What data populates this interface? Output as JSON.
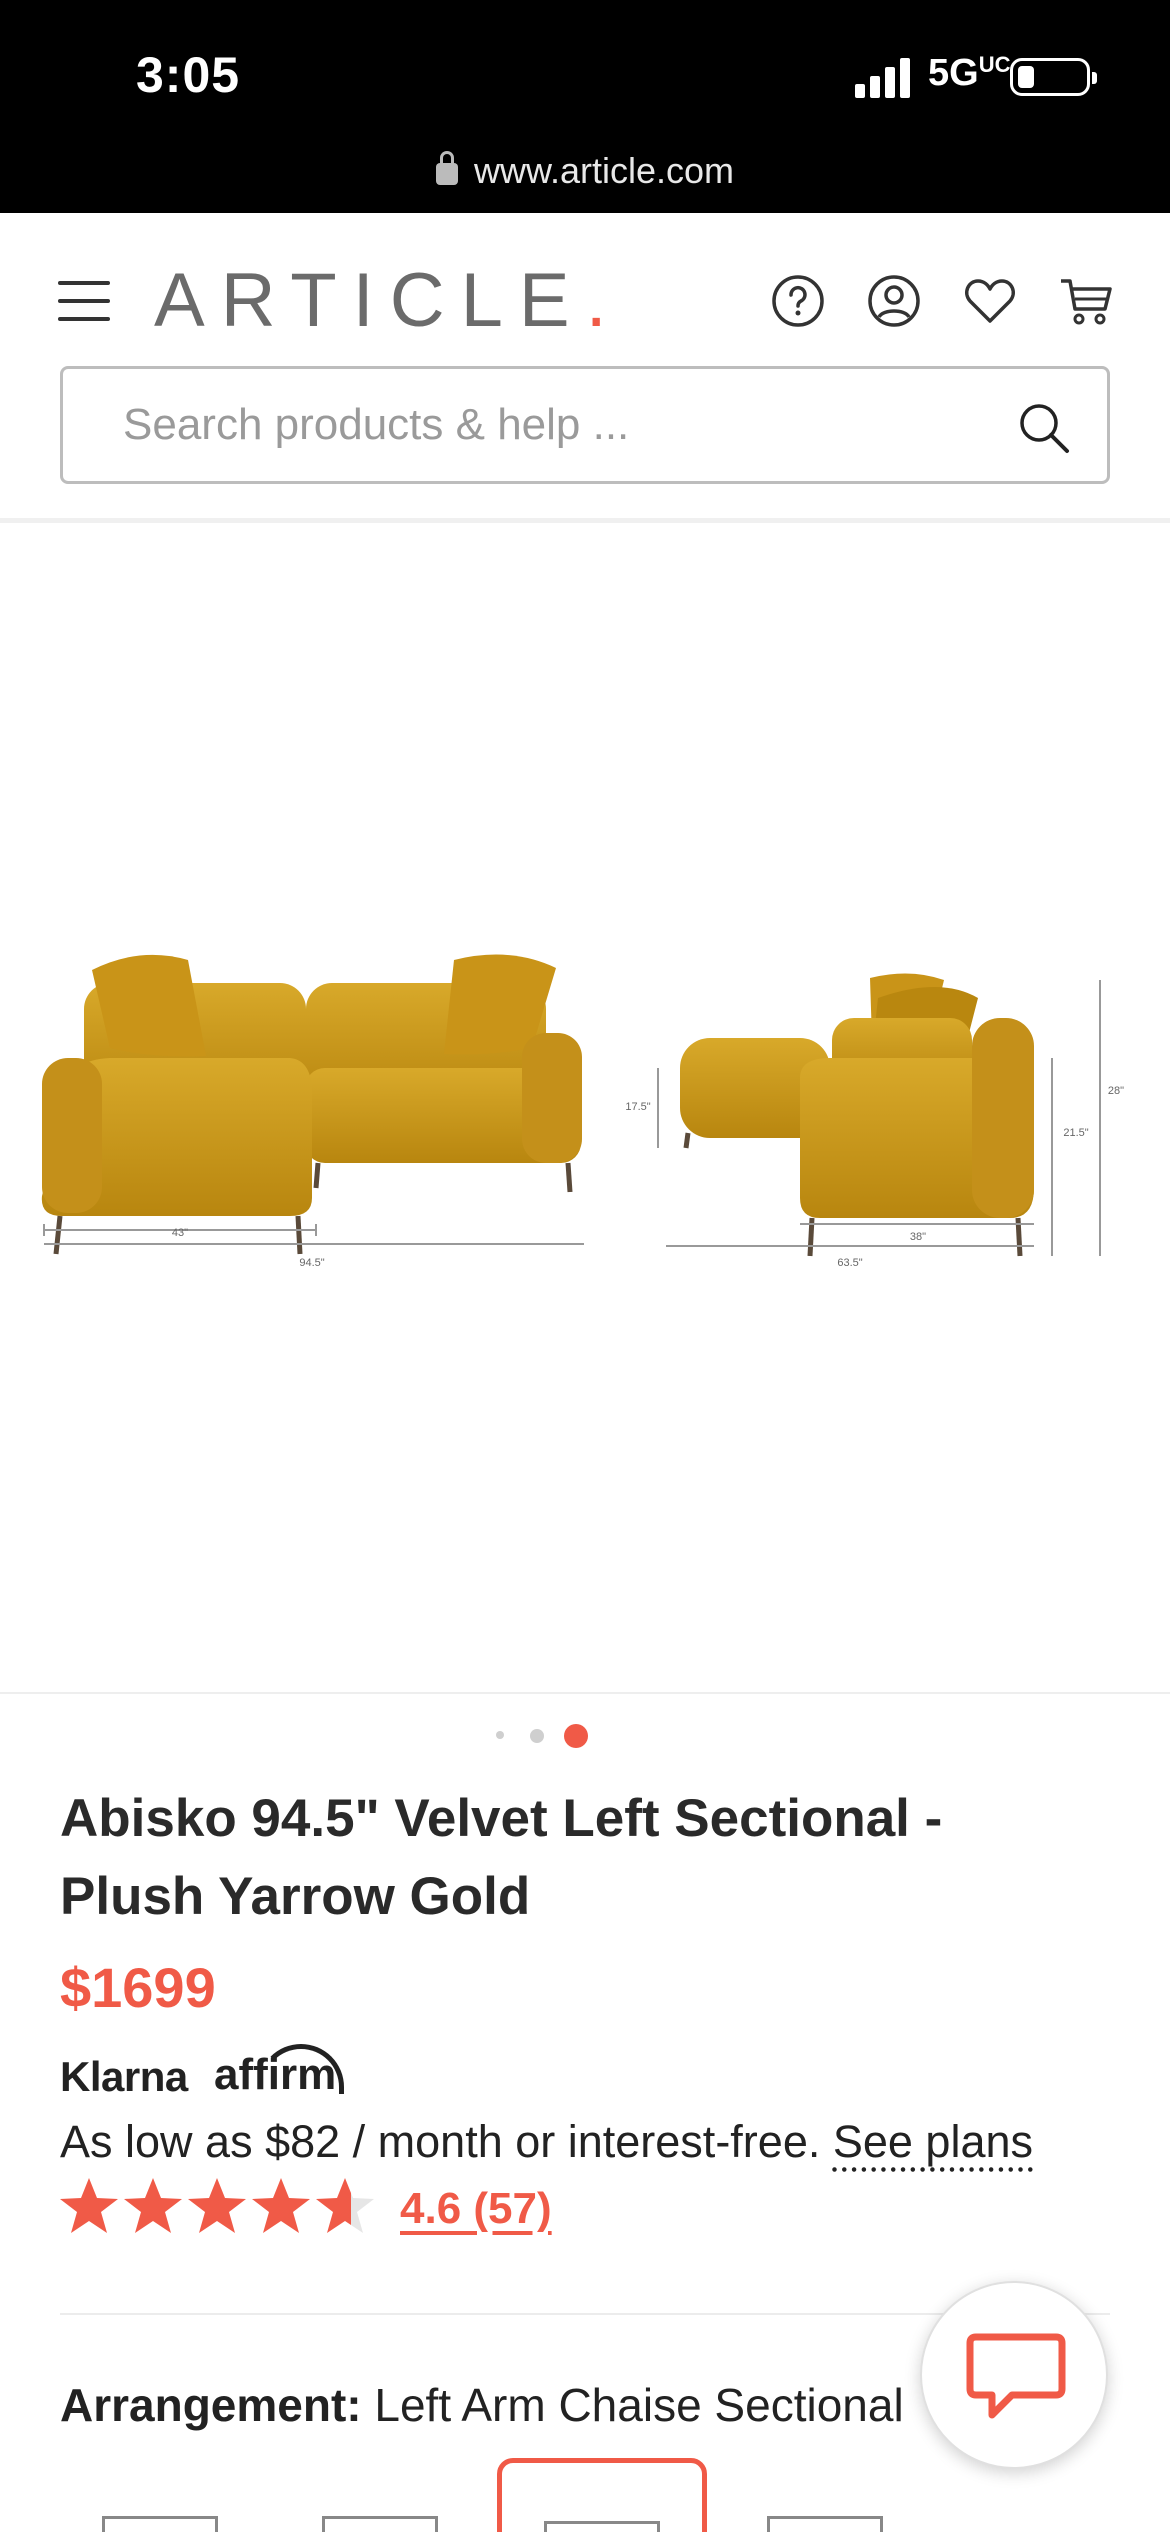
{
  "status_bar": {
    "time": "3:05",
    "network": "5G",
    "network_suffix": "UC",
    "url": "www.article.com"
  },
  "header": {
    "logo_text": "ARTICLE",
    "logo_dot": ".",
    "icons": [
      "menu-icon",
      "help-icon",
      "account-icon",
      "heart-icon",
      "cart-icon"
    ],
    "search_placeholder": "Search products & help ..."
  },
  "gallery": {
    "image_count": 3,
    "active_index": 2,
    "dimensions_front": {
      "chaise_width": "43\"",
      "total_width": "94.5\""
    },
    "dimensions_side": {
      "seat_height": "17.5\"",
      "arm_height": "21.5\"",
      "total_height": "28\"",
      "chaise_depth": "38\"",
      "depth": "63.5\""
    }
  },
  "product": {
    "title": "Abisko 94.5\" Velvet Left Sectional - Plush Yarrow Gold",
    "price": "$1699",
    "klarna_label": "Klarna",
    "affirm_label": "affirm",
    "financing_text": "As low as $82 / month or interest-free.",
    "financing_link": "See plans",
    "rating_value": 4.6,
    "rating_text": "4.6 (57)",
    "arrangement_label": "Arrangement:",
    "arrangement_value": "Left Arm Chaise Sectional"
  },
  "colors": {
    "accent": "#f05a47",
    "sofa": "#c9981a",
    "text": "#222222"
  }
}
